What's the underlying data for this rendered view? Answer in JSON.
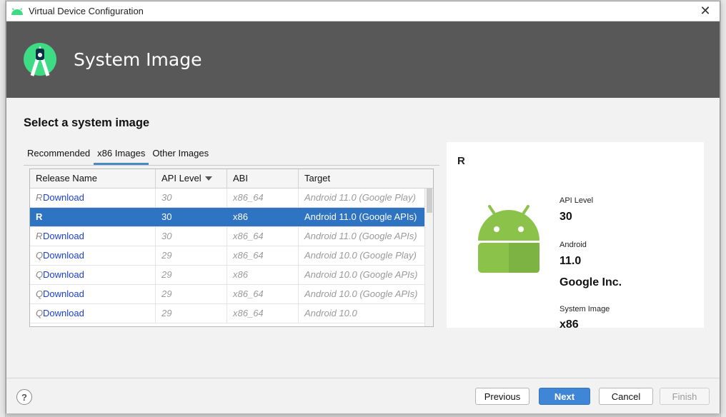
{
  "window": {
    "title": "Virtual Device Configuration",
    "close_glyph": "✕"
  },
  "banner": {
    "heading": "System Image"
  },
  "page": {
    "section_title": "Select a system image"
  },
  "tabs": [
    {
      "label": "Recommended",
      "active": false
    },
    {
      "label": "x86 Images",
      "active": true
    },
    {
      "label": "Other Images",
      "active": false
    }
  ],
  "table": {
    "columns": [
      "Release Name",
      "API Level",
      "ABI",
      "Target"
    ],
    "sorted_column": "API Level",
    "rows": [
      {
        "letter": "R",
        "release": "Download",
        "api": "30",
        "abi": "x86_64",
        "target": "Android 11.0 (Google Play)",
        "selected": false
      },
      {
        "letter": "",
        "release": "R",
        "api": "30",
        "abi": "x86",
        "target": "Android 11.0 (Google APIs)",
        "selected": true
      },
      {
        "letter": "R",
        "release": "Download",
        "api": "30",
        "abi": "x86_64",
        "target": "Android 11.0 (Google APIs)",
        "selected": false
      },
      {
        "letter": "Q",
        "release": "Download",
        "api": "29",
        "abi": "x86_64",
        "target": "Android 10.0 (Google Play)",
        "selected": false
      },
      {
        "letter": "Q",
        "release": "Download",
        "api": "29",
        "abi": "x86",
        "target": "Android 10.0 (Google APIs)",
        "selected": false
      },
      {
        "letter": "Q",
        "release": "Download",
        "api": "29",
        "abi": "x86_64",
        "target": "Android 10.0 (Google APIs)",
        "selected": false
      },
      {
        "letter": "Q",
        "release": "Download",
        "api": "29",
        "abi": "x86_64",
        "target": "Android 10.0",
        "selected": false
      }
    ]
  },
  "detail": {
    "release": "R",
    "api_label": "API Level",
    "api_value": "30",
    "android_label": "Android",
    "android_value": "11.0",
    "vendor": "Google Inc.",
    "sysimg_label": "System Image",
    "sysimg_value": "x86"
  },
  "footer": {
    "help": "?",
    "previous": "Previous",
    "next": "Next",
    "cancel": "Cancel",
    "finish": "Finish"
  },
  "colors": {
    "accent": "#3f86d6",
    "selection": "#2f73c3",
    "banner": "#585858",
    "android_green": "#8bc34a"
  }
}
